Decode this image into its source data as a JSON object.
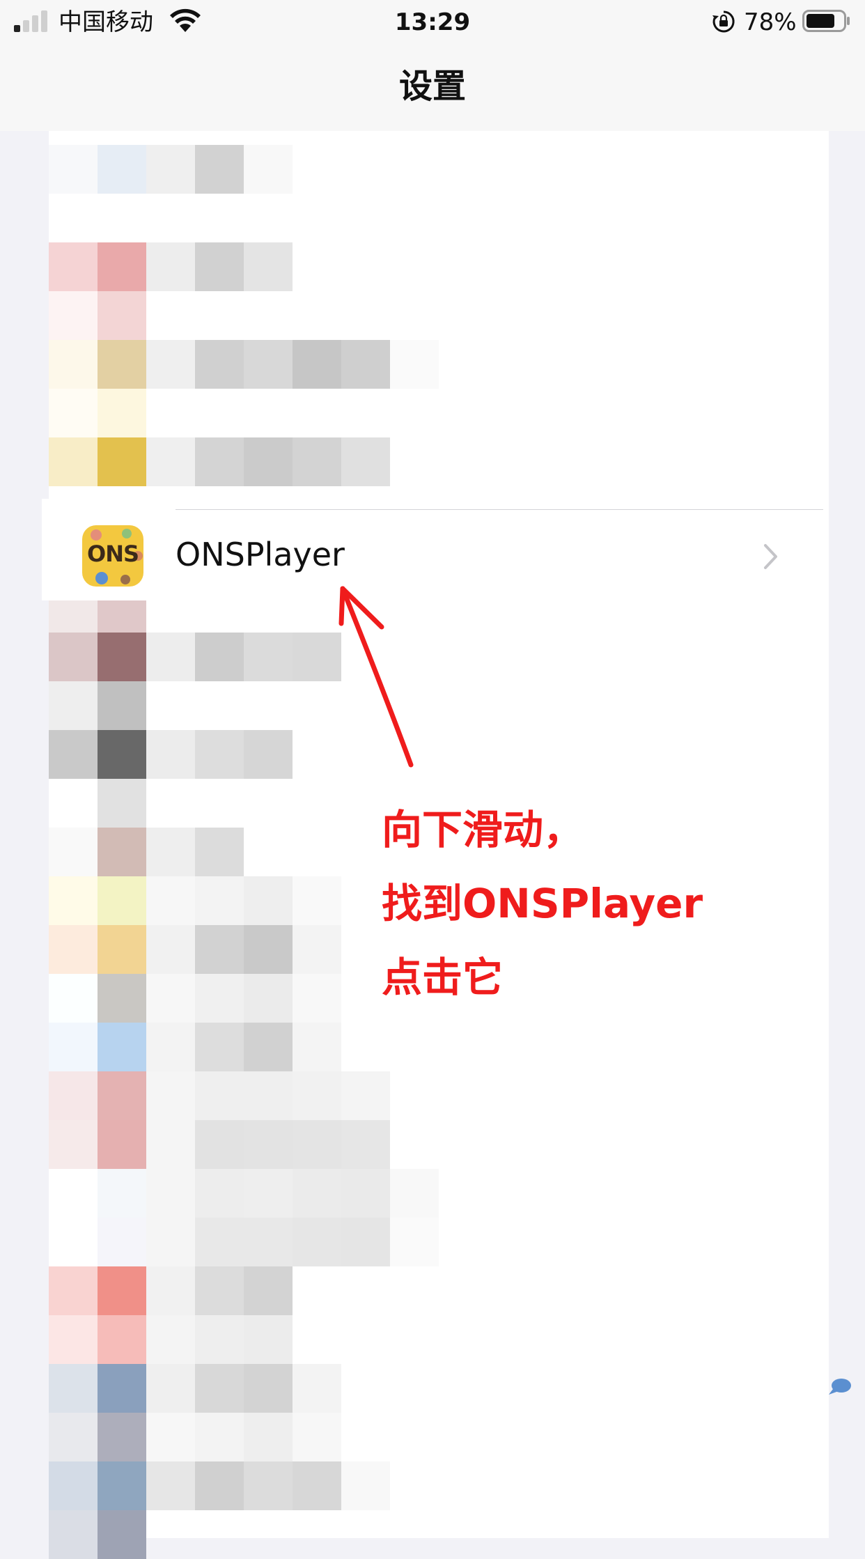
{
  "status_bar": {
    "carrier": "中国移动",
    "time": "13:29",
    "battery_percent": "78%",
    "battery_level": 0.78,
    "icons": [
      "signal-icon",
      "wifi-icon",
      "orientation-lock-icon",
      "battery-icon"
    ]
  },
  "nav": {
    "title": "设置"
  },
  "highlighted_row": {
    "label": "ONSPlayer",
    "icon": "onsplayer-app-icon",
    "icon_text": "ONS",
    "accessory": "chevron-right-icon"
  },
  "annotation": {
    "lines": [
      "向下滑动，",
      "找到ONSPlayer",
      "点击它"
    ],
    "color": "#ef1c1c"
  },
  "colors": {
    "background": "#f2f2f7",
    "bars": "#f7f7f7",
    "annotation": "#ef1c1c"
  }
}
